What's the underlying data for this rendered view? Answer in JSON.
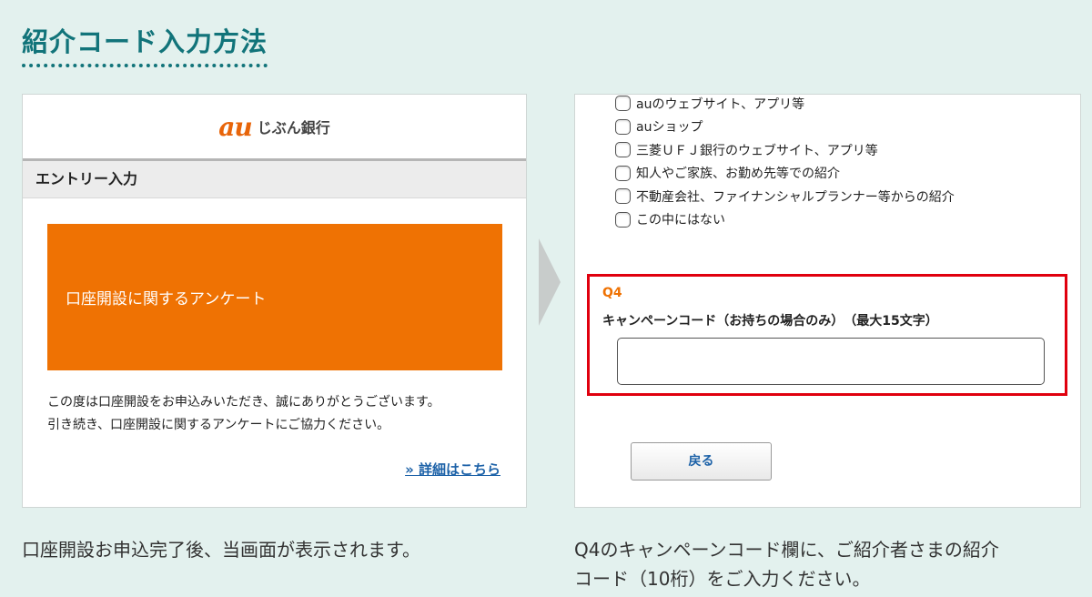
{
  "section_title": "紹介コード入力方法",
  "left_panel": {
    "logo_text": "au",
    "bank_name": "じぶん銀行",
    "entry_title": "エントリー入力",
    "banner_text": "口座開設に関するアンケート",
    "intro_line1": "この度は口座開設をお申込みいただき、誠にありがとうございます。",
    "intro_line2": "引き続き、口座開設に関するアンケートにご協力ください。",
    "details_link": "» 詳細はこちら"
  },
  "right_panel": {
    "options": [
      {
        "label": "auのウェブサイト、アプリ等"
      },
      {
        "label": "auショップ"
      },
      {
        "label": "三菱ＵＦＪ銀行のウェブサイト、アプリ等"
      },
      {
        "label": "知人やご家族、お勤め先等での紹介"
      },
      {
        "label": "不動産会社、ファイナンシャルプランナー等からの紹介"
      },
      {
        "label": "この中にはない"
      }
    ],
    "q4_label": "Q4",
    "q4_question": "キャンペーンコード（お持ちの場合のみ）　（最大15文字）",
    "campaign_input_value": "",
    "back_button": "戻る"
  },
  "captions": {
    "left": "口座開設お申込完了後、当画面が表示されます。",
    "right_line1": "Q4のキャンペーンコード欄に、ご紹介者さまの紹介",
    "right_line2": "コード（10桁）をご入力ください。"
  },
  "colors": {
    "background": "#e3f1ee",
    "title": "#12747a",
    "orange": "#ef7203",
    "highlight_red": "#e0000e",
    "link_blue": "#1d62a8"
  }
}
